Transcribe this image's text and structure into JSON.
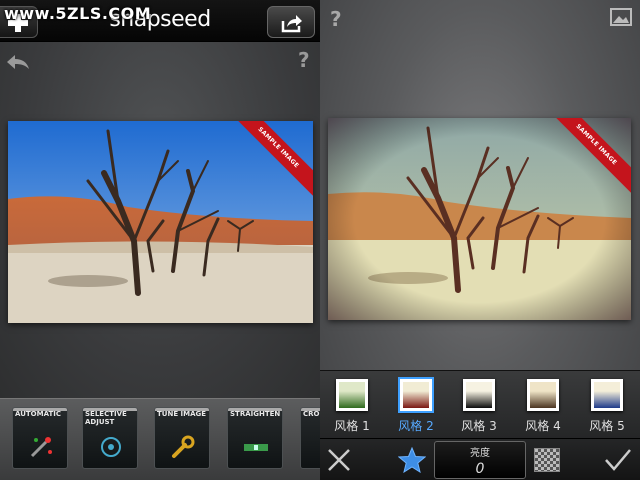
{
  "watermark": "www.5ZLS.COM",
  "left_pane": {
    "app_title": "snapseed",
    "photo_ribbon": "SAMPLE IMAGE",
    "help": "?",
    "tools": [
      {
        "label": "AUTOMATIC",
        "icon": "wand-icon"
      },
      {
        "label": "SELECTIVE\nADJUST",
        "icon": "target-icon"
      },
      {
        "label": "TUNE IMAGE",
        "icon": "wrench-icon"
      },
      {
        "label": "STRAIGHTEN",
        "icon": "level-icon"
      },
      {
        "label": "CRO",
        "icon": "crop-icon"
      }
    ]
  },
  "right_pane": {
    "help": "?",
    "photo_ribbon": "SAMPLE IMAGE",
    "styles": [
      {
        "label": "风格 1",
        "selected": false,
        "top": "#dfe8c8",
        "bottom": "#2f6a1e"
      },
      {
        "label": "风格 2",
        "selected": true,
        "top": "#f1ecd4",
        "bottom": "#7a1712"
      },
      {
        "label": "风格 3",
        "selected": false,
        "top": "#f6f2e2",
        "bottom": "#0c0c0c"
      },
      {
        "label": "风格 4",
        "selected": false,
        "top": "#efe4c7",
        "bottom": "#4b3420"
      },
      {
        "label": "风格 5",
        "selected": false,
        "top": "#f4eed9",
        "bottom": "#1e3a8a"
      }
    ],
    "brightness": {
      "label": "亮度",
      "value": "0"
    }
  },
  "colors": {
    "accent": "#3ea0ff",
    "ribbon": "#c4141c"
  }
}
